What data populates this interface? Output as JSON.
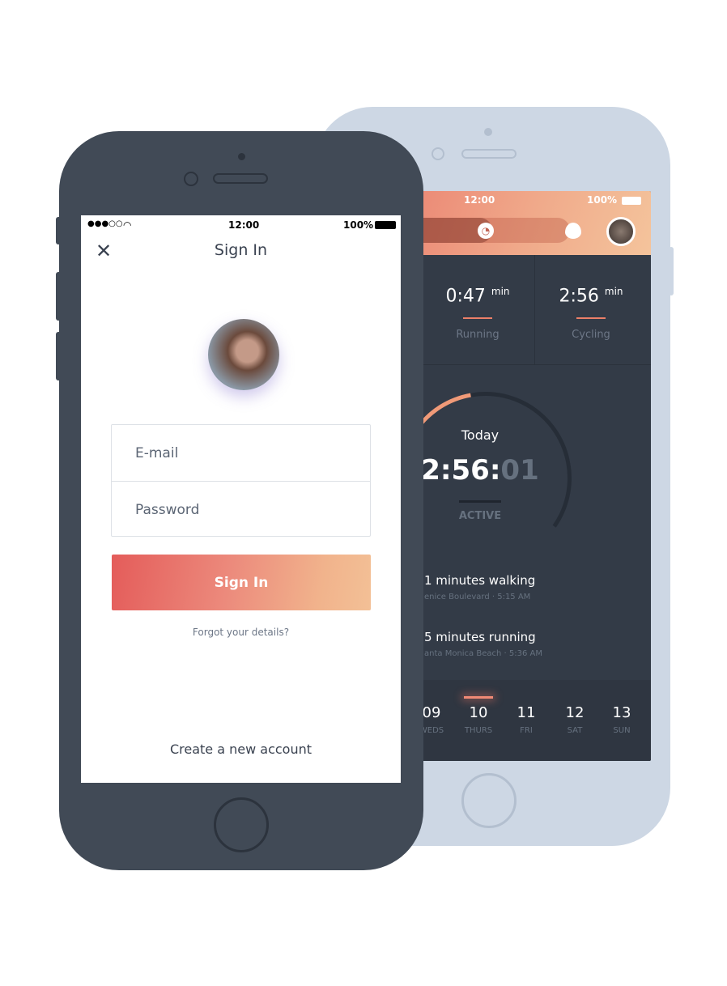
{
  "back_phone": {
    "status": {
      "time": "12:00",
      "battery": "100%"
    },
    "toggle": {
      "left_icon": "clock-icon",
      "right_icon": "flame-icon"
    },
    "stats": [
      {
        "value": "0:47",
        "unit": "min",
        "label": "Running"
      },
      {
        "value": "2:56",
        "unit": "min",
        "label": "Cycling"
      }
    ],
    "today": {
      "label": "Today",
      "time_main": "2:56:",
      "time_dim": "01",
      "status": "ACTIVE",
      "progress": 0.35
    },
    "activities": [
      {
        "title": "1 minutes walking",
        "subtitle": "enice Boulevard · 5:15 AM"
      },
      {
        "title": "5 minutes running",
        "subtitle": "anta Monica Beach  ·  5:36 AM"
      }
    ],
    "days": [
      {
        "num": "09",
        "name": "WEDS"
      },
      {
        "num": "10",
        "name": "THURS"
      },
      {
        "num": "11",
        "name": "FRI"
      },
      {
        "num": "12",
        "name": "SAT"
      },
      {
        "num": "13",
        "name": "SUN"
      }
    ],
    "selected_day": "10"
  },
  "front_phone": {
    "status": {
      "signal": "●●●○○",
      "time": "12:00",
      "battery": "100%"
    },
    "title": "Sign In",
    "email_placeholder": "E-mail",
    "password_placeholder": "Password",
    "signin_label": "Sign In",
    "forgot": "Forgot your details?",
    "create": "Create a new account"
  },
  "colors": {
    "accent": "#ec7f68",
    "dark": "#333b47"
  }
}
